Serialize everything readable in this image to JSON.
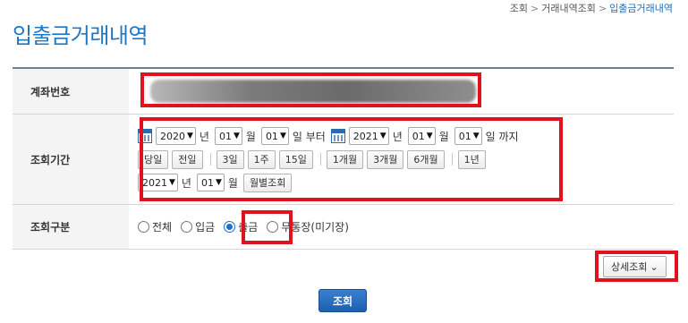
{
  "breadcrumb": {
    "item1": "조회",
    "item2": "거래내역조회",
    "current": "입출금거래내역",
    "sep": ">"
  },
  "page_title": "입출금거래내역",
  "form": {
    "account": {
      "label": "계좌번호"
    },
    "period": {
      "label": "조회기간",
      "from_year": "2020",
      "year_unit": "년",
      "from_month": "01",
      "month_unit": "월",
      "from_day": "01",
      "from_suffix": "일 부터",
      "to_year": "2021",
      "to_month": "01",
      "to_day": "01",
      "to_suffix": "일 까지",
      "quick_buttons": [
        "당일",
        "전일",
        "3일",
        "1주",
        "15일",
        "1개월",
        "3개월",
        "6개월",
        "1년"
      ],
      "monthly_year": "2021",
      "monthly_month": "01",
      "monthly_button": "월별조회"
    },
    "type": {
      "label": "조회구분",
      "options": [
        "전체",
        "입금",
        "출금",
        "무통장(미기장)"
      ],
      "selected": "출금"
    }
  },
  "detail_button": "상세조회",
  "search_button": "조회",
  "colors": {
    "accent": "#1e78c8",
    "highlight": "#e0121d",
    "button": "#1e5fae"
  }
}
